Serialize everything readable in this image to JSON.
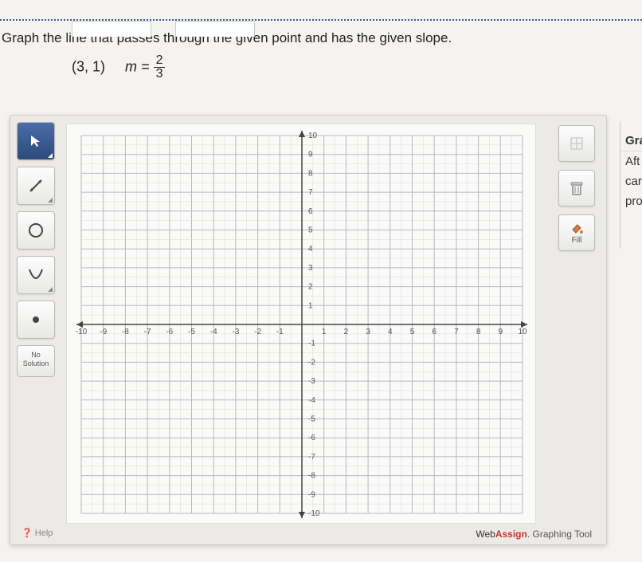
{
  "instruction": "Graph the line that passes through the given point and has the given slope.",
  "point": "(3, 1)",
  "slope_var": "m =",
  "slope_num": "2",
  "slope_den": "3",
  "tools": {
    "pointer": "↖",
    "line": "↗",
    "circle": "○",
    "parabola": "∪",
    "point": "•",
    "no_solution_l1": "No",
    "no_solution_l2": "Solution"
  },
  "right_tools": {
    "fill_label": "Fill"
  },
  "help": "Help",
  "footer_web": "Web",
  "footer_assign": "Assign",
  "footer_tool": ". Graphing Tool",
  "side": {
    "gra": "Gra",
    "aft": "Aft",
    "car": "car",
    "pro": "pro"
  },
  "chart_data": {
    "type": "scatter",
    "xlim": [
      -10,
      10
    ],
    "ylim": [
      -10,
      10
    ],
    "x_ticks": [
      -10,
      -9,
      -8,
      -7,
      -6,
      -5,
      -4,
      -3,
      -2,
      -1,
      1,
      2,
      3,
      4,
      5,
      6,
      7,
      8,
      9,
      10
    ],
    "y_ticks": [
      -10,
      -9,
      -8,
      -7,
      -6,
      -5,
      -4,
      -3,
      -2,
      -1,
      1,
      2,
      3,
      4,
      5,
      6,
      7,
      8,
      9,
      10
    ],
    "series": [],
    "title": "",
    "xlabel": "",
    "ylabel": ""
  }
}
